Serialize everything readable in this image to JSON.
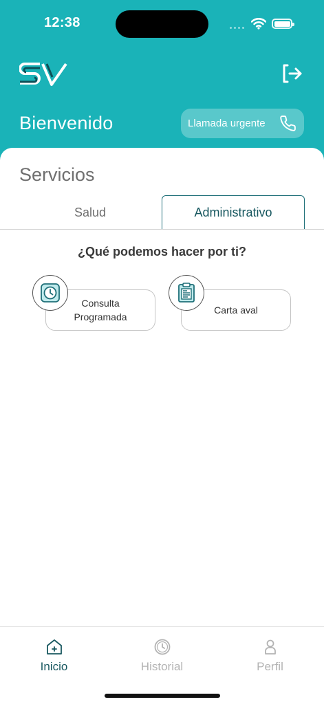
{
  "status_bar": {
    "time": "12:38"
  },
  "header": {
    "logo_text": "SV",
    "welcome": "Bienvenido",
    "urgent_call_label": "Llamada urgente"
  },
  "services": {
    "title": "Servicios",
    "tabs": [
      {
        "label": "Salud",
        "active": false
      },
      {
        "label": "Administrativo",
        "active": true
      }
    ],
    "question": "¿Qué podemos hacer por ti?",
    "cards": [
      {
        "label_line1": "Consulta",
        "label_line2": "Programada",
        "icon": "clock-icon"
      },
      {
        "label": "Carta aval",
        "icon": "clipboard-icon"
      }
    ]
  },
  "bottom_nav": {
    "items": [
      {
        "label": "Inicio",
        "icon": "home-icon",
        "active": true
      },
      {
        "label": "Historial",
        "icon": "clock-icon",
        "active": false
      },
      {
        "label": "Perfil",
        "icon": "user-icon",
        "active": false
      }
    ]
  },
  "colors": {
    "brand_teal": "#1ab3b8",
    "dark_teal": "#17575f",
    "inactive_gray": "#b3b3b3"
  }
}
